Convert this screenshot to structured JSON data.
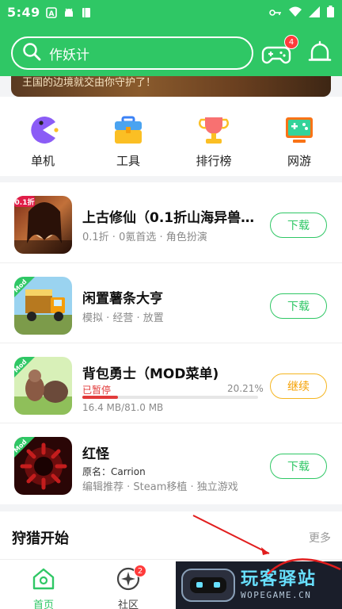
{
  "status": {
    "time": "5:49"
  },
  "header": {
    "search_placeholder": "作妖计",
    "gamepad_badge": "4"
  },
  "banner": {
    "text": "王国的边境就交由你守护了！"
  },
  "categories": [
    {
      "label": "单机",
      "icon": "pacman-icon"
    },
    {
      "label": "工具",
      "icon": "toolbox-icon"
    },
    {
      "label": "排行榜",
      "icon": "trophy-icon"
    },
    {
      "label": "网游",
      "icon": "console-icon"
    }
  ],
  "apps": [
    {
      "name": "上古修仙（0.1折山海异兽…",
      "meta": "0.1折 · 0氪首选 · 角色扮演",
      "button": "下载",
      "thumb_tag": "0.1折"
    },
    {
      "name": "闲置薯条大亨",
      "meta": "模拟 · 经营 · 放置",
      "button": "下载",
      "thumb_tag": "Mod"
    },
    {
      "name": "背包勇士（MOD菜单)",
      "status": "已暂停",
      "percent": "20.21%",
      "progress": 0.2021,
      "size": "16.4 MB/81.0 MB",
      "button": "继续",
      "thumb_tag": "Mod"
    },
    {
      "name": "红怪",
      "original_name": "原名：Carrion",
      "meta": "编辑推荐 · Steam移植 · 独立游戏",
      "button": "下载",
      "thumb_tag": "Mod"
    }
  ],
  "section": {
    "title": "狩猎开始",
    "more": "更多"
  },
  "nav": {
    "home": "首页",
    "community": "社区",
    "community_badge": "2"
  },
  "watermark": {
    "text": "玩客驿站",
    "sub": "WOPEGAME.CN"
  },
  "colors": {
    "brand": "#2fc765",
    "accent_orange": "#f5a000",
    "badge_red": "#ff3b3b"
  }
}
